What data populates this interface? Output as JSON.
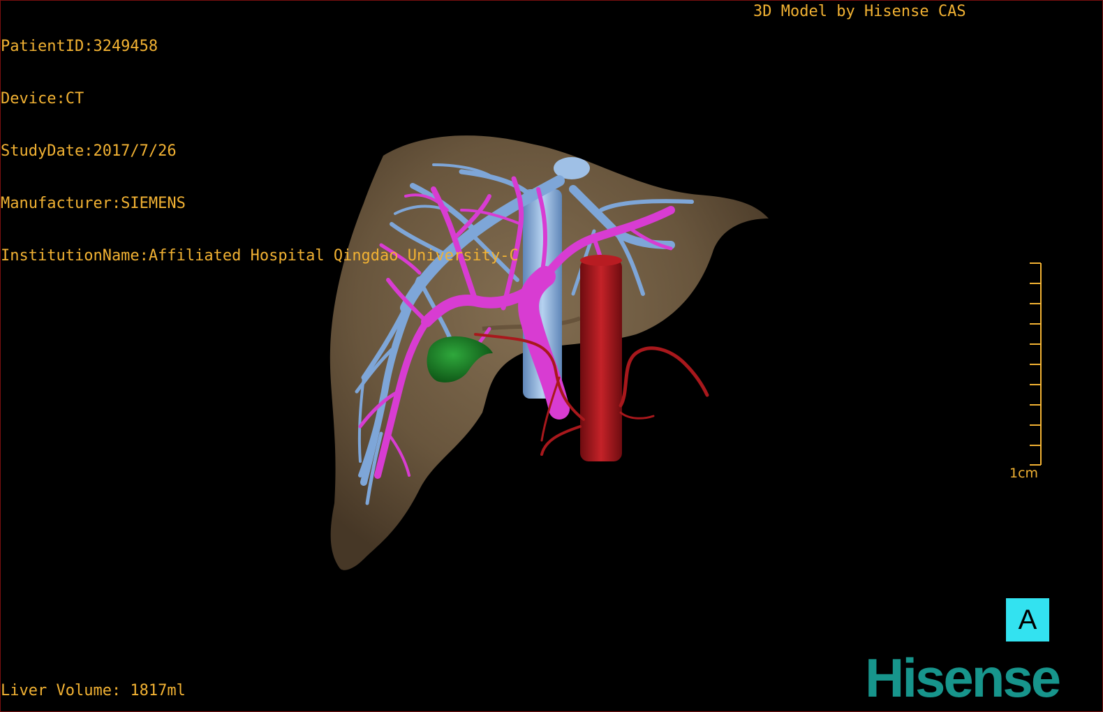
{
  "patient_info": {
    "patient_id": "PatientID:3249458",
    "device": "Device:CT",
    "study_date": "StudyDate:2017/7/26",
    "manufacturer": "Manufacturer:SIEMENS",
    "institution": "InstitutionName:Affiliated Hospital Qingdao University-C"
  },
  "credit": "3D Model by Hisense CAS",
  "liver_volume": "Liver Volume: 1817ml",
  "scale_bar": {
    "label": "1cm"
  },
  "orientation": {
    "label": "A"
  },
  "brand": "Hisense",
  "colors": {
    "text": "#f2b233",
    "liver": "#7a6448",
    "hepatic_vein": "#7ea6d8",
    "portal_vein": "#d83cd2",
    "artery_aorta": "#a8181c",
    "gallbladder": "#1f8a2c",
    "orientation_box": "#33e2f0",
    "brand": "#17958c"
  }
}
